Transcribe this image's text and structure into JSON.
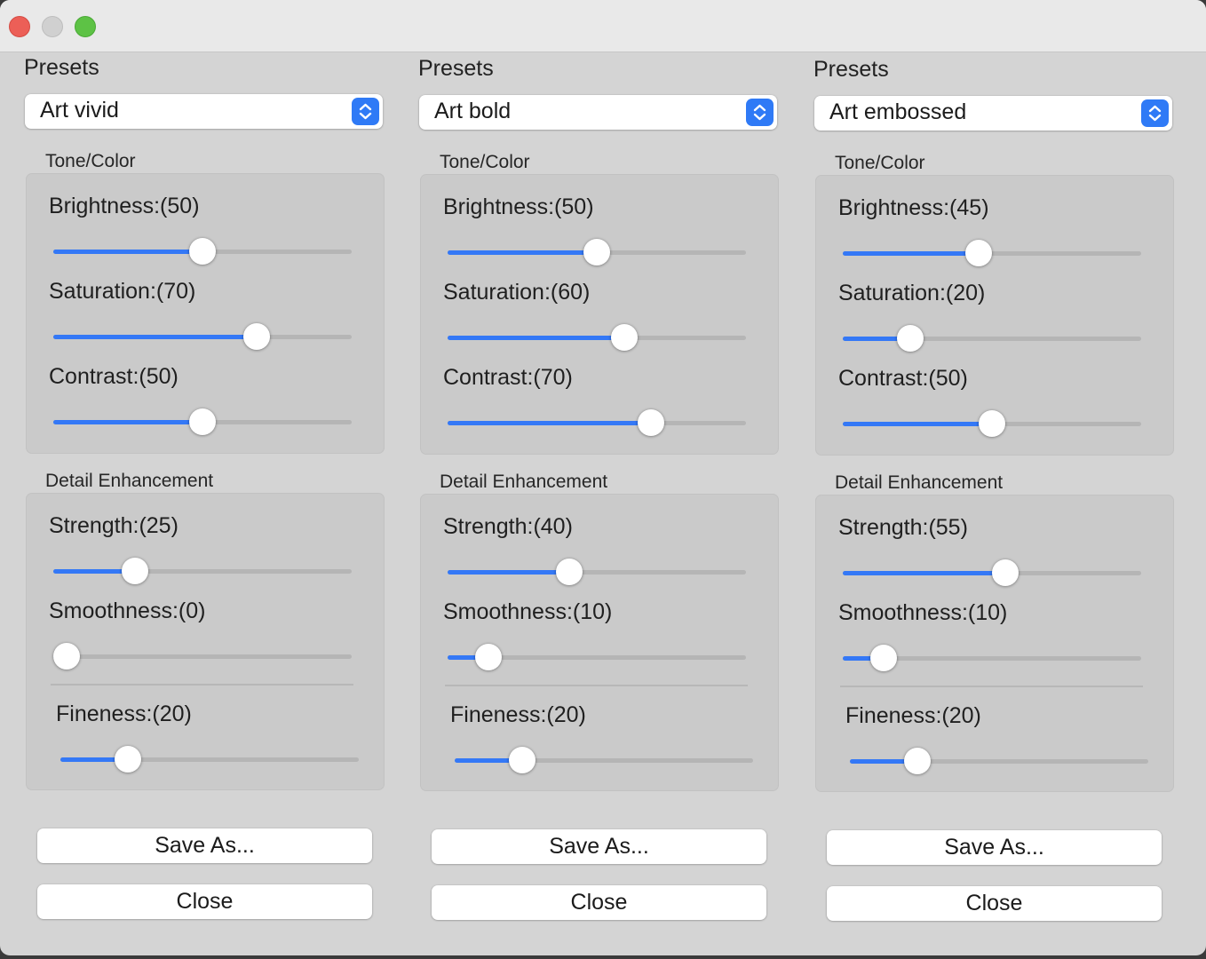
{
  "window": {
    "traffic_lights": [
      "close",
      "minimize",
      "zoom"
    ],
    "colors": {
      "close": "#ec5f57",
      "minimize": "#d0d0d0",
      "zoom": "#5dc245",
      "accent": "#3478f6"
    }
  },
  "panels": [
    {
      "presets_label": "Presets",
      "preset_value": "Art vivid",
      "tone_title": "Tone/Color",
      "brightness": {
        "label": "Brightness:(50)",
        "value": 50
      },
      "saturation": {
        "label": "Saturation:(70)",
        "value": 70
      },
      "contrast": {
        "label": "Contrast:(50)",
        "value": 50
      },
      "detail_title": "Detail Enhancement",
      "strength": {
        "label": "Strength:(25)",
        "value": 25
      },
      "smoothness": {
        "label": "Smoothness:(0)",
        "value": 0
      },
      "fineness": {
        "label": "Fineness:(20)",
        "value": 20
      },
      "save_label": "Save As...",
      "close_label": "Close"
    },
    {
      "presets_label": "Presets",
      "preset_value": "Art bold",
      "tone_title": "Tone/Color",
      "brightness": {
        "label": "Brightness:(50)",
        "value": 50
      },
      "saturation": {
        "label": "Saturation:(60)",
        "value": 60
      },
      "contrast": {
        "label": "Contrast:(70)",
        "value": 70
      },
      "detail_title": "Detail Enhancement",
      "strength": {
        "label": "Strength:(40)",
        "value": 40
      },
      "smoothness": {
        "label": "Smoothness:(10)",
        "value": 10
      },
      "fineness": {
        "label": "Fineness:(20)",
        "value": 20
      },
      "save_label": "Save As...",
      "close_label": "Close"
    },
    {
      "presets_label": "Presets",
      "preset_value": "Art embossed",
      "tone_title": "Tone/Color",
      "brightness": {
        "label": "Brightness:(45)",
        "value": 45
      },
      "saturation": {
        "label": "Saturation:(20)",
        "value": 20
      },
      "contrast": {
        "label": "Contrast:(50)",
        "value": 50
      },
      "detail_title": "Detail Enhancement",
      "strength": {
        "label": "Strength:(55)",
        "value": 55
      },
      "smoothness": {
        "label": "Smoothness:(10)",
        "value": 10
      },
      "fineness": {
        "label": "Fineness:(20)",
        "value": 20
      },
      "save_label": "Save As...",
      "close_label": "Close"
    }
  ]
}
